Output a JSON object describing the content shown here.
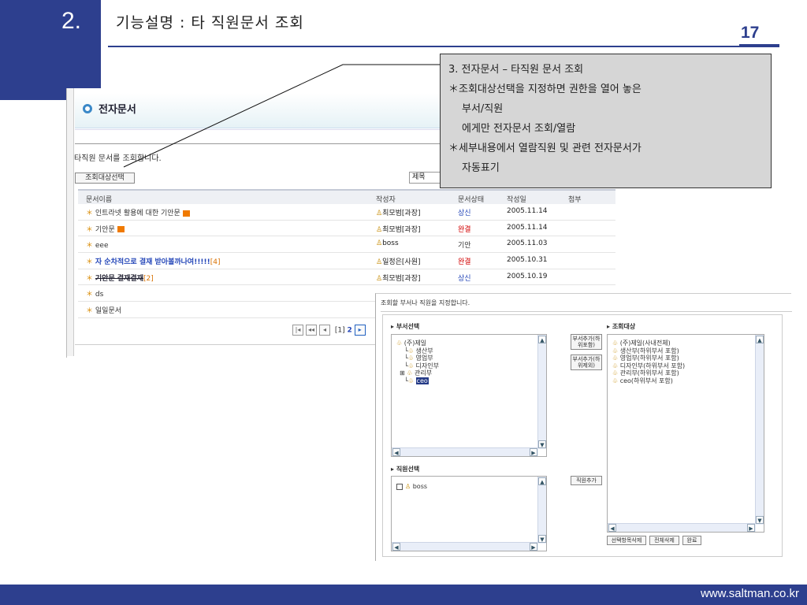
{
  "slide": {
    "section_number": "2.",
    "title": "기능설명 : 타 직원문서 조회",
    "page_number": "17",
    "footer_url": "www.saltman.co.kr",
    "colors": {
      "brand": "#2d3f8e",
      "callout_bg": "#d6d6d6"
    }
  },
  "callout": {
    "lines": [
      "3. 전자문서 – 타직원 문서 조회",
      "＊조회대상선택을 지정하면 권한을 열어 놓은",
      "부서/직원",
      "에게만 전자문서 조회/열람",
      "＊세부내용에서 열람직원 및 관련 전자문서가",
      "자동표기"
    ]
  },
  "doc_screen": {
    "header": "전자문서",
    "description": "타직원 문서를 조회합니다.",
    "select_target_button": "조회대상선택",
    "search_field_select": "제목",
    "columns": [
      "문서이름",
      "작성자",
      "문서상태",
      "작성일",
      "첨부"
    ],
    "rows": [
      {
        "bullet": "＊",
        "name": "인트라넷 활용에 대한 기안문",
        "count": "",
        "author": "최모범[과장]",
        "status": "상신",
        "date": "2005.11.14"
      },
      {
        "bullet": "＊",
        "name": "기안문",
        "count": "",
        "author": "최모범[과장]",
        "status": "완결",
        "date": "2005.11.14"
      },
      {
        "bullet": "＊",
        "name": "eee",
        "count": "",
        "author": "boss",
        "status": "기안",
        "date": "2005.11.03"
      },
      {
        "bullet": "＊",
        "name": "자 순차적으로 결재 받아볼까나여!!!!!",
        "count": "[4]",
        "author": "일정은[사원]",
        "status": "완결",
        "date": "2005.10.31"
      },
      {
        "bullet": "＊",
        "name": "기안문 결재결재",
        "count": "[2]",
        "author": "최모범[과장]",
        "status": "상신",
        "date": "2005.10.19"
      },
      {
        "bullet": "＊",
        "name": "ds",
        "count": "",
        "author": "",
        "status": "",
        "date": ""
      },
      {
        "bullet": "＊",
        "name": "일일문서",
        "count": "",
        "author": "",
        "status": "",
        "date": ""
      }
    ],
    "pager": {
      "current": "[1]",
      "next": "2"
    }
  },
  "target_dialog": {
    "description": "조회할 부서나 직원을 지정합니다.",
    "dept_label": "부서선택",
    "dept_tree": [
      "(주)제일",
      "생산부",
      "영업부",
      "디자인부",
      "관리부",
      "ceo"
    ],
    "add_dept_incl_button": "부서추가(하위포함)",
    "add_dept_excl_button": "부서추가(하위제외)",
    "target_label": "조회대상",
    "targets": [
      "(주)제일(사내전체)",
      "생산부(하위부서 포함)",
      "영업부(하위부서 포함)",
      "디자인부(하위부서 포함)",
      "관리부(하위부서 포함)",
      "ceo(하위부서 포함)"
    ],
    "staff_label": "직원선택",
    "staff": [
      "boss"
    ],
    "add_staff_button": "직원추가",
    "delete_selected_button": "선택항목삭제",
    "delete_all_button": "전체삭제",
    "done_button": "완료"
  }
}
